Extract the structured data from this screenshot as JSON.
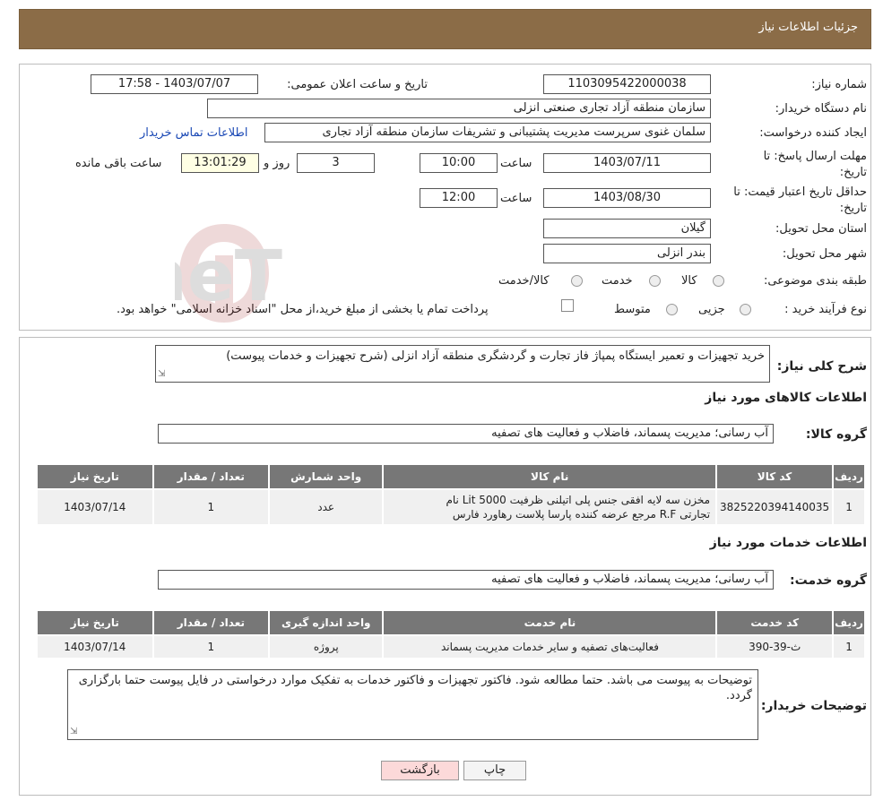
{
  "header": {
    "title": "جزئیات اطلاعات نیاز"
  },
  "form": {
    "need_number_label": "شماره نیاز:",
    "need_number": "1103095422000038",
    "announce_label": "تاریخ و ساعت اعلان عمومی:",
    "announce_value": "1403/07/07 - 17:58",
    "buyer_label": "نام دستگاه خریدار:",
    "buyer_value": "سازمان منطقه آزاد تجاری  صنعتی انزلی",
    "creator_label": "ایجاد کننده درخواست:",
    "creator_value": "سلمان غنوی سرپرست مدیریت پشتیبانی و تشریفات سازمان منطقه آزاد تجاری",
    "contact_link": "اطلاعات تماس خریدار",
    "deadline_label": "مهلت ارسال پاسخ: تا تاریخ:",
    "deadline_date": "1403/07/11",
    "time_label": "ساعت",
    "deadline_time": "10:00",
    "days_value": "3",
    "days_label": "روز و",
    "remaining_time": "13:01:29",
    "remaining_label": "ساعت باقی مانده",
    "validity_label": "حداقل تاریخ اعتبار قیمت: تا تاریخ:",
    "validity_date": "1403/08/30",
    "validity_time": "12:00",
    "province_label": "استان محل تحویل:",
    "province_value": "گیلان",
    "city_label": "شهر محل تحویل:",
    "city_value": "بندر انزلی",
    "category_label": "طبقه بندی موضوعی:",
    "category_options": [
      "کالا",
      "خدمت",
      "کالا/خدمت"
    ],
    "process_label": "نوع فرآیند خرید :",
    "process_options": [
      "جزیی",
      "متوسط"
    ],
    "process_note": "پرداخت تمام یا بخشی از مبلغ خرید،از محل \"اسناد خزانه اسلامی\" خواهد بود."
  },
  "description": {
    "label": "شرح کلی نیاز:",
    "value": "خرید تجهیزات و تعمیر ایستگاه پمپاژ فاز تجارت و گردشگری منطقه آزاد انزلی (شرح تجهیزات و خدمات پیوست)"
  },
  "goods": {
    "section_title": "اطلاعات کالاهای مورد نیاز",
    "group_label": "گروه کالا:",
    "group_value": "آب رسانی؛ مدیریت پسماند، فاضلاب و فعالیت های تصفیه",
    "headers": [
      "ردیف",
      "کد کالا",
      "نام کالا",
      "واحد شمارش",
      "تعداد / مقدار",
      "تاریخ نیاز"
    ],
    "rows": [
      {
        "row": "1",
        "code": "3825220394140035",
        "name_line1": "مخزن سه لایه افقی جنس پلی اتیلنی ظرفیت 5000 Lit نام",
        "name_line2": "تجارتی R.F مرجع عرضه کننده پارسا پلاست رهاورد فارس",
        "unit": "عدد",
        "qty": "1",
        "date": "1403/07/14"
      }
    ]
  },
  "services": {
    "section_title": "اطلاعات خدمات مورد نیاز",
    "group_label": "گروه خدمت:",
    "group_value": "آب رسانی؛ مدیریت پسماند، فاضلاب و فعالیت های تصفیه",
    "headers": [
      "ردیف",
      "کد خدمت",
      "نام خدمت",
      "واحد اندازه گیری",
      "تعداد / مقدار",
      "تاریخ نیاز"
    ],
    "rows": [
      {
        "row": "1",
        "code": "ث-39-390",
        "name": "فعالیت‌های تصفیه و سایر خدمات مدیریت پسماند",
        "unit": "پروژه",
        "qty": "1",
        "date": "1403/07/14"
      }
    ]
  },
  "buyer_notes": {
    "label": "توضیحات خریدار:",
    "value": "توضیحات به پیوست می باشد. حتما مطالعه شود. فاکتور تجهیزات و فاکتور خدمات به تفکیک موارد درخواستی در فایل پیوست حتما بارگزاری گردد."
  },
  "buttons": {
    "print": "چاپ",
    "back": "بازگشت"
  },
  "watermark": {
    "text": "AriaTender.neT"
  }
}
